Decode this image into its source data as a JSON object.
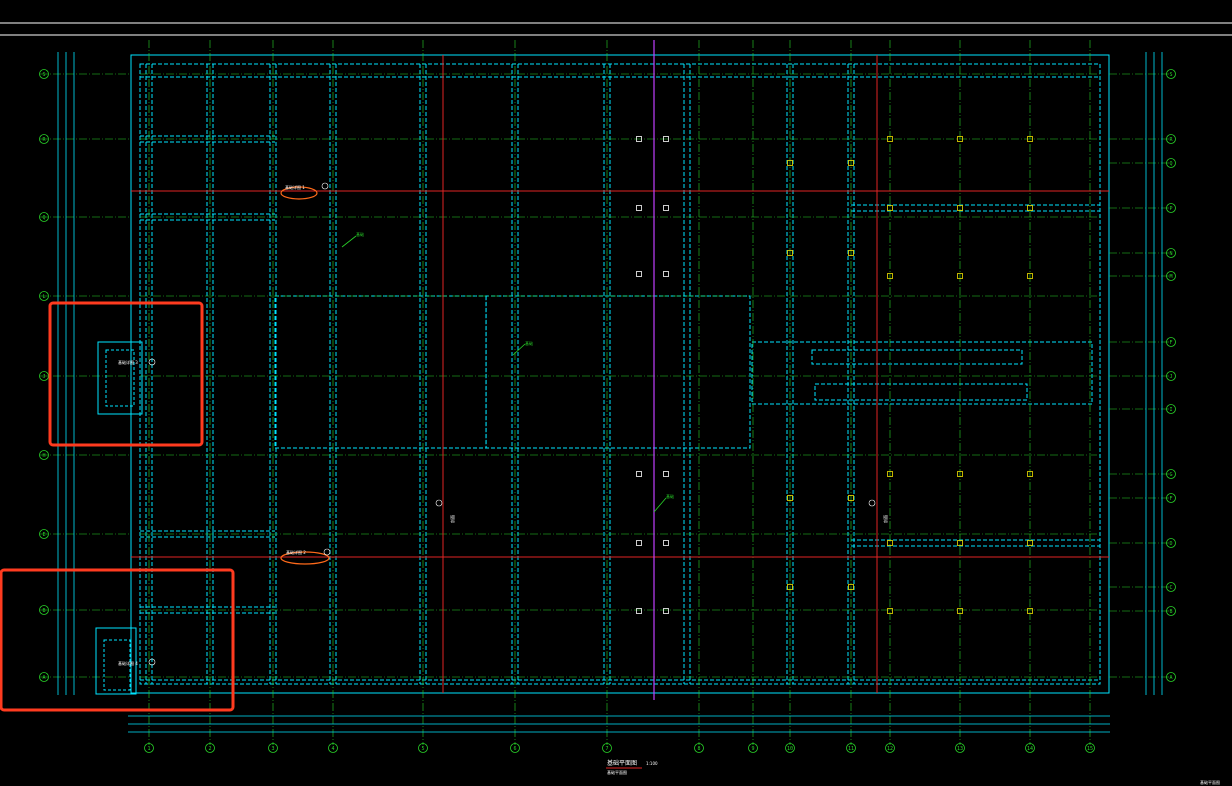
{
  "app": {
    "title": ""
  },
  "colors": {
    "background": "#000000",
    "wall": "#00e5ff",
    "axis": "#29d329",
    "section_line": "#e02424",
    "special_line": "#c040ff",
    "column": "#f0e000",
    "annotation_highlight": "#ff3b1f",
    "text": "#ffffff"
  },
  "drawing": {
    "title": "基础平面图",
    "scale": "1:100",
    "subtitle": "基础平面图",
    "corner_stamp": "基础平面图"
  },
  "axes": {
    "bottom_labels": [
      "1",
      "2",
      "3",
      "4",
      "5",
      "6",
      "7",
      "8",
      "9",
      "10",
      "11",
      "12",
      "13",
      "14",
      "15"
    ],
    "left_labels": [
      "S",
      "R",
      "Q",
      "L",
      "J",
      "H",
      "E",
      "B",
      "A"
    ],
    "right_labels": [
      "S",
      "R",
      "Q",
      "P",
      "N",
      "M",
      "F",
      "J",
      "I",
      "G",
      "F",
      "D",
      "C",
      "B",
      "A"
    ]
  },
  "annotations": {
    "callout_1": "基础详图 1",
    "callout_2": "基础详图 2",
    "callout_left_1": "基础详图 3",
    "callout_left_2": "基础详图 4",
    "green_tag_1": "基础",
    "green_tag_2": "基础",
    "green_tag_3": "基础",
    "section_mark_1": "剖面",
    "section_mark_2": "剖面"
  },
  "highlights": [
    {
      "label": "left-detail-highlight"
    },
    {
      "label": "bottom-left-detail-highlight"
    }
  ]
}
